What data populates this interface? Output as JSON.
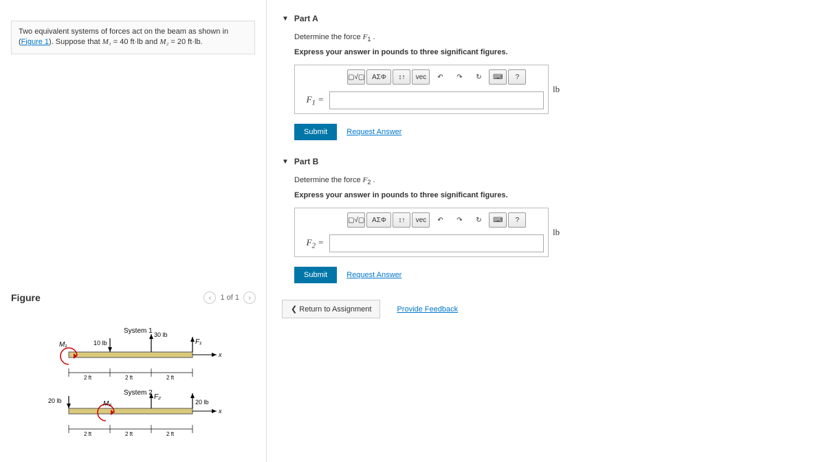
{
  "problem": {
    "text_before": "Two equivalent systems of forces act on the beam as shown in (",
    "figure_link": "Figure 1",
    "text_after": "). Suppose that ",
    "m1_sym": "M₁",
    "m1_val": " = 40 ft·lb and ",
    "m2_sym": "M₂",
    "m2_val": " = 20 ft·lb."
  },
  "figure": {
    "title": "Figure",
    "nav_text": "1 of 1",
    "diagram": {
      "sys1": "System 1",
      "sys2": "System 2",
      "lbl_30": "30 lb",
      "lbl_10": "10 lb",
      "lbl_20": "20 lb",
      "lbl_2ft": "2 ft",
      "M1": "M₁",
      "M2": "M₂",
      "F1": "F₁",
      "F2": "F₂",
      "x": "x"
    }
  },
  "partA": {
    "title": "Part A",
    "determine": "Determine the force F₁ .",
    "express": "Express your answer in pounds to three significant figures.",
    "label": "F₁ =",
    "unit": "lb"
  },
  "partB": {
    "title": "Part B",
    "determine": "Determine the force F₂ .",
    "express": "Express your answer in pounds to three significant figures.",
    "label": "F₂ =",
    "unit": "lb"
  },
  "toolbar": {
    "template": "▢√▢",
    "greek": "ΑΣΦ",
    "scripts": "↕↑",
    "vec": "vec",
    "undo": "↶",
    "redo": "↷",
    "reset": "↻",
    "keyboard": "⌨",
    "help": "?"
  },
  "actions": {
    "submit": "Submit",
    "request": "Request Answer",
    "return": "❮ Return to Assignment",
    "feedback": "Provide Feedback"
  }
}
